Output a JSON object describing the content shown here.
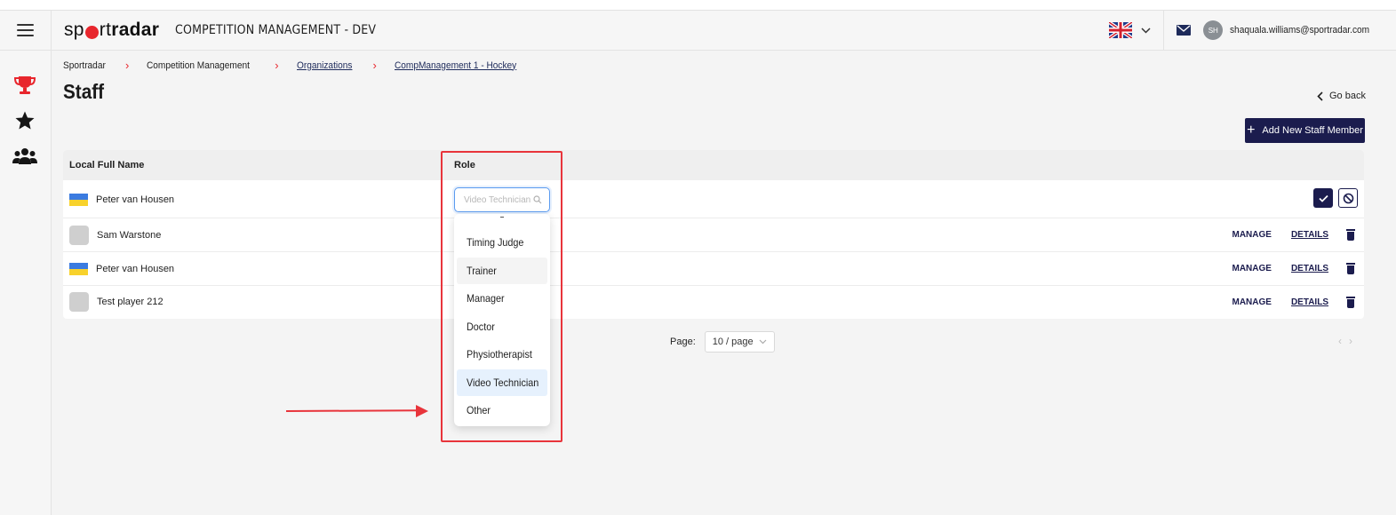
{
  "header": {
    "logo_pre": "sp",
    "logo_mid": "rt",
    "logo_bold": "radar",
    "app_title": "COMPETITION MANAGEMENT - DEV",
    "avatar_initials": "SH",
    "user_email": "shaquala.williams@sportradar.com",
    "icons": [
      "hamburger-icon",
      "flag-uk-icon",
      "chevron-down-icon",
      "mail-icon"
    ]
  },
  "sidebar": {
    "items": [
      {
        "icon": "trophy-icon",
        "active": true
      },
      {
        "icon": "star-icon",
        "active": false
      },
      {
        "icon": "users-icon",
        "active": false
      }
    ]
  },
  "breadcrumb": {
    "items": [
      "Sportradar",
      "Competition Management",
      "Organizations",
      "CompManagement 1 - Hockey"
    ]
  },
  "page": {
    "title": "Staff",
    "go_back": "Go back",
    "add_button": "Add New Staff Member"
  },
  "table": {
    "columns": [
      "Local Full Name",
      "Role"
    ],
    "rows": [
      {
        "name": "Peter van Housen",
        "flag": "ukraine",
        "editing": true
      },
      {
        "name": "Sam Warstone",
        "flag": "placeholder",
        "manage": "MANAGE",
        "details": "DETAILS"
      },
      {
        "name": "Peter van Housen",
        "flag": "ukraine",
        "manage": "MANAGE",
        "details": "DETAILS"
      },
      {
        "name": "Test player 212",
        "flag": "placeholder",
        "manage": "MANAGE",
        "details": "DETAILS"
      }
    ]
  },
  "role_select": {
    "placeholder": "Video Technician",
    "options": [
      "Timing Judge",
      "Trainer",
      "Manager",
      "Doctor",
      "Physiotherapist",
      "Video Technician",
      "Other"
    ],
    "hovered": "Trainer",
    "selected": "Video Technician"
  },
  "pagination": {
    "label": "Page:",
    "page_size": "10 / page"
  },
  "colors": {
    "brand_red": "#e8262d",
    "navy": "#1b1c4e",
    "annotation_red": "#e8343b",
    "selected_bg": "#e6f1fd"
  }
}
